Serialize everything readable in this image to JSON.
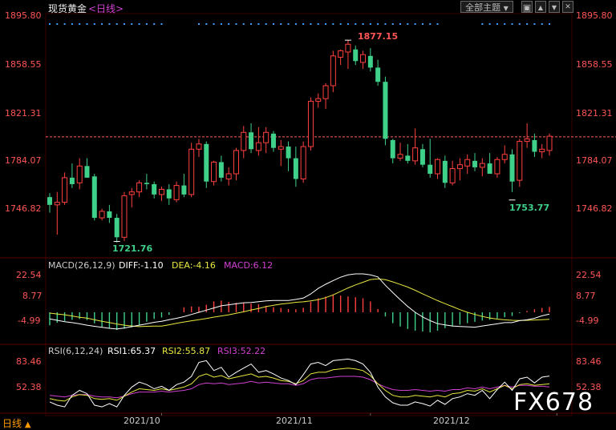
{
  "header": {
    "title": "现货黄金",
    "period_bracket": "<日线>",
    "theme_button": "全部主题",
    "theme_arrow": "▼"
  },
  "window_controls": {
    "maximize": "▣",
    "up": "▲",
    "down": "▼",
    "close": "✕"
  },
  "colors": {
    "up": "#ff4040",
    "down": "#3fd08a",
    "diff_line": "#ffffff",
    "dea_line": "#e8e840",
    "rsi1": "#ffffff",
    "rsi2": "#e8e840",
    "rsi3": "#d040d0",
    "title_label": "#cccccc"
  },
  "price_axis": {
    "labels": [
      "1895.80",
      "1858.55",
      "1821.31",
      "1784.07",
      "1746.82"
    ],
    "reference_line": 1802.5
  },
  "price_annotations": {
    "high": "1877.15",
    "low1": "1721.76",
    "low2": "1753.77"
  },
  "macd": {
    "title": "MACD(26,12,9)",
    "diff": "DIFF:-1.10",
    "dea": "DEA:-4.16",
    "macd": "MACD:6.12",
    "axis_labels": [
      "22.54",
      "8.77",
      "-4.99"
    ]
  },
  "rsi": {
    "title": "RSI(6,12,24)",
    "rsi1": "RSI1:65.37",
    "rsi2": "RSI2:55.87",
    "rsi3": "RSI3:52.22",
    "axis_labels": [
      "83.46",
      "52.38"
    ]
  },
  "x_axis": {
    "labels": [
      "2021/10",
      "2021/11",
      "2021/12"
    ]
  },
  "period_label": "日线",
  "period_arrow": "▲",
  "watermark": "FX678",
  "chart_data": {
    "type": "candlestick",
    "ylim": [
      1715,
      1900
    ],
    "candles": [
      [
        1756,
        1759,
        1744,
        1750
      ],
      [
        1750,
        1760,
        1727,
        1752
      ],
      [
        1752,
        1775,
        1750,
        1771
      ],
      [
        1771,
        1782,
        1763,
        1766
      ],
      [
        1767,
        1786,
        1762,
        1780
      ],
      [
        1780,
        1786,
        1771,
        1771
      ],
      [
        1772,
        1774,
        1738,
        1740
      ],
      [
        1740,
        1747,
        1738,
        1745
      ],
      [
        1745,
        1750,
        1736,
        1740
      ],
      [
        1740,
        1743,
        1721,
        1725
      ],
      [
        1725,
        1760,
        1722,
        1757
      ],
      [
        1758,
        1763,
        1748,
        1760
      ],
      [
        1760,
        1769,
        1756,
        1767
      ],
      [
        1767,
        1774,
        1762,
        1766
      ],
      [
        1766,
        1768,
        1755,
        1758
      ],
      [
        1758,
        1764,
        1753,
        1762
      ],
      [
        1762,
        1766,
        1750,
        1755
      ],
      [
        1754,
        1768,
        1752,
        1765
      ],
      [
        1765,
        1774,
        1756,
        1758
      ],
      [
        1758,
        1798,
        1756,
        1793
      ],
      [
        1793,
        1801,
        1787,
        1797
      ],
      [
        1797,
        1799,
        1763,
        1768
      ],
      [
        1768,
        1784,
        1765,
        1783
      ],
      [
        1783,
        1788,
        1768,
        1771
      ],
      [
        1770,
        1779,
        1765,
        1774
      ],
      [
        1774,
        1794,
        1769,
        1792
      ],
      [
        1792,
        1811,
        1786,
        1806
      ],
      [
        1806,
        1813,
        1790,
        1793
      ],
      [
        1792,
        1810,
        1788,
        1798
      ],
      [
        1798,
        1810,
        1790,
        1806
      ],
      [
        1805,
        1807,
        1791,
        1794
      ],
      [
        1793,
        1800,
        1780,
        1795
      ],
      [
        1795,
        1799,
        1776,
        1786
      ],
      [
        1786,
        1795,
        1764,
        1770
      ],
      [
        1770,
        1799,
        1767,
        1795
      ],
      [
        1795,
        1833,
        1792,
        1830
      ],
      [
        1830,
        1836,
        1825,
        1832
      ],
      [
        1832,
        1844,
        1824,
        1842
      ],
      [
        1842,
        1869,
        1837,
        1865
      ],
      [
        1864,
        1870,
        1858,
        1869
      ],
      [
        1868,
        1877,
        1855,
        1874
      ],
      [
        1870,
        1873,
        1858,
        1861
      ],
      [
        1860,
        1869,
        1855,
        1866
      ],
      [
        1865,
        1871,
        1853,
        1856
      ],
      [
        1856,
        1862,
        1842,
        1845
      ],
      [
        1845,
        1849,
        1796,
        1801
      ],
      [
        1800,
        1801,
        1782,
        1786
      ],
      [
        1786,
        1798,
        1784,
        1789
      ],
      [
        1788,
        1797,
        1782,
        1784
      ],
      [
        1784,
        1809,
        1781,
        1794
      ],
      [
        1793,
        1797,
        1779,
        1781
      ],
      [
        1781,
        1801,
        1771,
        1774
      ],
      [
        1774,
        1786,
        1770,
        1785
      ],
      [
        1784,
        1788,
        1763,
        1767
      ],
      [
        1767,
        1784,
        1765,
        1778
      ],
      [
        1778,
        1786,
        1769,
        1781
      ],
      [
        1780,
        1789,
        1774,
        1785
      ],
      [
        1784,
        1790,
        1776,
        1779
      ],
      [
        1779,
        1786,
        1772,
        1782
      ],
      [
        1782,
        1790,
        1775,
        1774
      ],
      [
        1774,
        1787,
        1771,
        1785
      ],
      [
        1785,
        1796,
        1782,
        1789
      ],
      [
        1789,
        1793,
        1760,
        1768
      ],
      [
        1769,
        1801,
        1764,
        1799
      ],
      [
        1799,
        1813,
        1794,
        1801
      ],
      [
        1800,
        1805,
        1787,
        1791
      ],
      [
        1791,
        1797,
        1786,
        1793
      ],
      [
        1792,
        1805,
        1788,
        1803
      ]
    ],
    "macd": {
      "histogram": [
        -7.8,
        -6.2,
        -5.2,
        -4.5,
        -4,
        -4.7,
        -6.6,
        -8.8,
        -9.5,
        -10.6,
        -9.8,
        -9,
        -7.6,
        -5.6,
        -4,
        -3.1,
        -1.5,
        0,
        3,
        3.5,
        3.3,
        4.5,
        6.5,
        7,
        6.1,
        5.7,
        5.5,
        5.2,
        4.8,
        3.9,
        3.1,
        2.6,
        2,
        1.8,
        2.7,
        6.3,
        8.4,
        9.4,
        10.7,
        10,
        9.5,
        9,
        8.4,
        6.5,
        2,
        -2.5,
        -6.5,
        -8.5,
        -10,
        -11,
        -11.5,
        -12,
        -11,
        -9.5,
        -8.5,
        -7.4,
        -6.5,
        -5.7,
        -5,
        -4.5,
        -3.7,
        -3,
        -2.2,
        -0.5,
        0.8,
        1.8,
        2.6,
        3.2
      ],
      "diff": [
        -4,
        -4.8,
        -5.6,
        -6.2,
        -6.9,
        -7.7,
        -8.4,
        -9,
        -9.6,
        -10,
        -9.4,
        -8.6,
        -7.7,
        -6.9,
        -6,
        -5.4,
        -4.4,
        -3.6,
        -2.6,
        -1.3,
        0,
        1.3,
        2.6,
        3.9,
        4.5,
        5.1,
        5.7,
        5.9,
        6.4,
        6.8,
        7.1,
        7.1,
        7.1,
        7.7,
        8.5,
        11,
        14.3,
        16.8,
        19,
        21,
        22.4,
        23,
        23,
        22.4,
        21.2,
        16.2,
        11.8,
        7.6,
        3.5,
        0,
        -2.8,
        -5,
        -6.8,
        -7.6,
        -8.2,
        -8.5,
        -8.7,
        -8.9,
        -8.2,
        -7.6,
        -6.9,
        -6.2,
        -6.2,
        -5,
        -4.5,
        -3.6,
        -2.1,
        -1.1
      ],
      "dea": [
        -0.5,
        -1,
        -1.5,
        -2.2,
        -3,
        -3.5,
        -4.5,
        -5.4,
        -6.2,
        -7,
        -7.7,
        -8.2,
        -8.6,
        -8.4,
        -8.3,
        -8.3,
        -7.5,
        -6.6,
        -5.8,
        -5.1,
        -4.4,
        -3.7,
        -2.9,
        -2.2,
        -1.5,
        -0.6,
        0.3,
        1.4,
        2.3,
        3.4,
        4.2,
        4.9,
        5.4,
        6,
        6.3,
        6.8,
        7.6,
        8.8,
        10.4,
        12.5,
        14.6,
        16.4,
        18,
        19.6,
        20,
        19.5,
        18.2,
        16.7,
        15.1,
        13.2,
        11.1,
        9,
        7,
        5.2,
        3.4,
        1.6,
        0,
        -1.3,
        -2.5,
        -3.4,
        -4.1,
        -4.5,
        -4.8,
        -4.9,
        -4.8,
        -4.6,
        -4.4,
        -4.16
      ]
    },
    "rsi": {
      "rsi1": [
        34,
        30,
        28,
        42,
        48,
        44,
        30,
        28,
        32,
        28,
        42,
        52,
        58,
        55,
        50,
        53,
        48,
        55,
        58,
        65,
        82,
        84,
        72,
        76,
        64,
        70,
        75,
        80,
        70,
        72,
        68,
        63,
        60,
        55,
        67,
        80,
        82,
        78,
        84,
        85,
        86,
        84,
        80,
        70,
        52,
        40,
        33,
        30,
        30,
        34,
        32,
        29,
        36,
        31,
        38,
        40,
        44,
        42,
        48,
        38,
        49,
        58,
        48,
        62,
        64,
        57,
        64,
        65.37
      ],
      "rsi2": [
        38,
        36,
        35,
        40,
        43,
        42,
        38,
        37,
        38,
        36,
        41,
        46,
        50,
        49,
        48,
        50,
        48,
        50,
        52,
        56,
        65,
        68,
        64,
        66,
        62,
        64,
        66,
        68,
        64,
        65,
        63,
        60,
        59,
        56,
        60,
        68,
        70,
        70,
        73,
        74,
        75,
        74,
        72,
        66,
        56,
        48,
        42,
        40,
        40,
        42,
        41,
        40,
        42,
        40,
        44,
        45,
        48,
        47,
        50,
        46,
        50,
        54,
        50,
        55,
        56,
        54,
        55,
        55.87
      ],
      "rsi3": [
        42,
        41,
        40,
        42,
        43,
        43,
        41,
        40,
        40,
        39,
        41,
        44,
        46,
        46,
        46,
        47,
        46,
        47,
        48,
        50,
        55,
        57,
        56,
        57,
        55,
        56,
        57,
        59,
        57,
        58,
        57,
        56,
        56,
        54,
        56,
        61,
        63,
        63,
        64,
        65,
        65,
        65,
        64,
        61,
        56,
        52,
        49,
        48,
        48,
        49,
        48,
        47,
        48,
        47,
        49,
        49,
        51,
        50,
        52,
        50,
        52,
        54,
        52,
        54,
        54,
        53,
        53,
        52.22
      ]
    },
    "rsi_ylim": [
      0,
      100
    ]
  }
}
